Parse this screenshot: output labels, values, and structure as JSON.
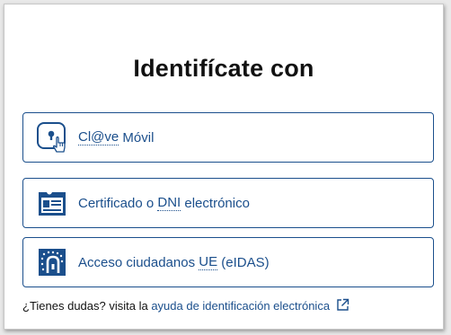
{
  "title": "Identifícate con",
  "options": [
    {
      "label_pre": "Cl@ve",
      "label_post": " Móvil",
      "icon": "clave-lock-icon"
    },
    {
      "label_pre": "Certificado o ",
      "label_abbr": "DNI",
      "label_post": " electrónico",
      "icon": "certificate-card-icon"
    },
    {
      "label_pre": "Acceso ciudadanos ",
      "label_abbr": "UE",
      "label_post": " (eIDAS)",
      "icon": "eu-lock-icon"
    }
  ],
  "footer": {
    "text": "¿Tienes dudas? visita la ",
    "link": "ayuda de identificación electrónica",
    "link_icon": "external-link-icon"
  },
  "colors": {
    "accent": "#1b4f8c",
    "text": "#111111",
    "background": "#ffffff"
  }
}
